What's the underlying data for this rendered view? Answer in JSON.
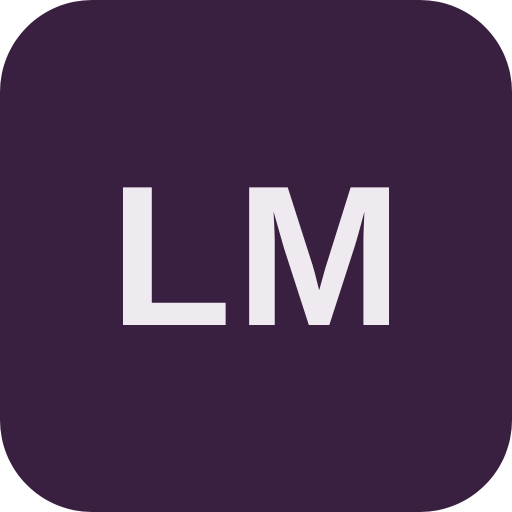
{
  "icon": {
    "text": "LM",
    "colors": {
      "background": "#3a2040",
      "text": "#efeaf0"
    }
  }
}
